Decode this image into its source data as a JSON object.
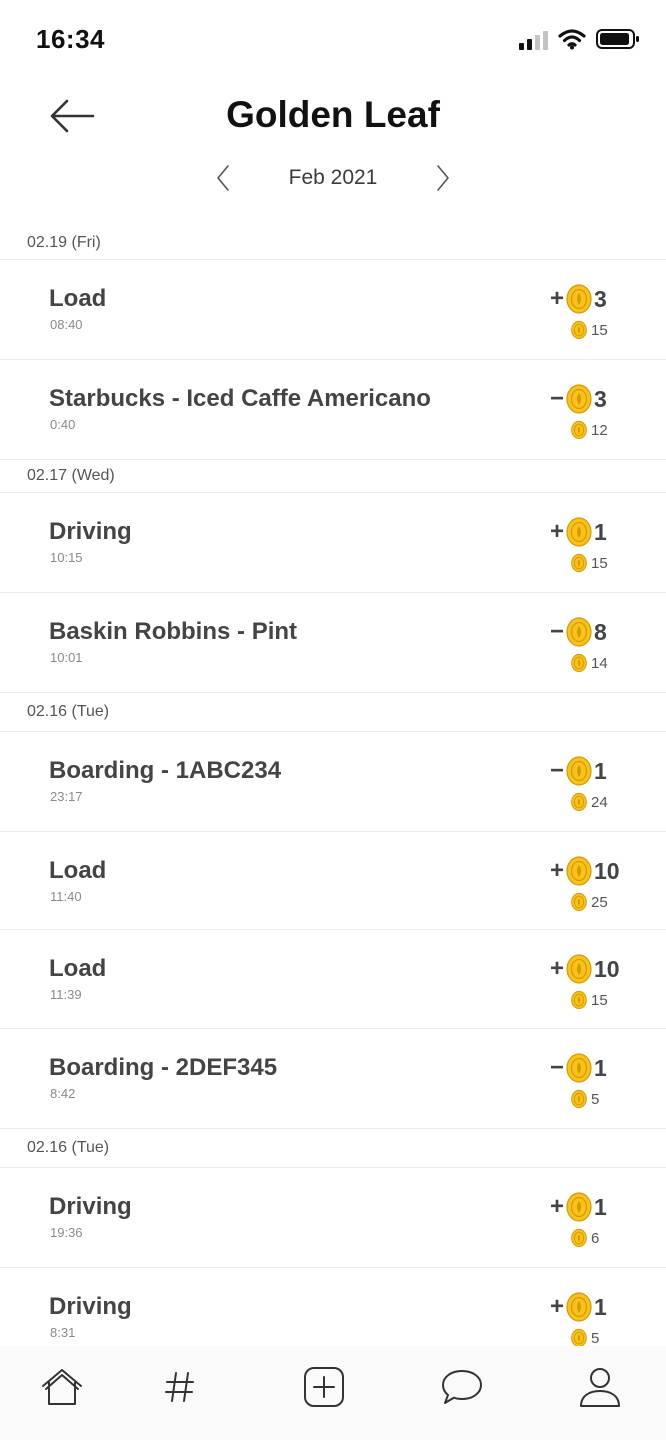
{
  "status_bar": {
    "time": "16:34"
  },
  "header": {
    "title": "Golden Leaf",
    "month": "Feb 2021"
  },
  "sections": [
    {
      "date": "02.19 (Fri)",
      "transactions": [
        {
          "title": "Load",
          "time": "08:40",
          "sign": "+",
          "amount": "3",
          "balance": "15"
        },
        {
          "title": "Starbucks - Iced Caffe Americano",
          "time": "0:40",
          "sign": "−",
          "amount": "3",
          "balance": "12"
        }
      ]
    },
    {
      "date": "02.17 (Wed)",
      "transactions": [
        {
          "title": "Driving",
          "time": "10:15",
          "sign": "+",
          "amount": "1",
          "balance": "15"
        },
        {
          "title": "Baskin Robbins - Pint",
          "time": "10:01",
          "sign": "−",
          "amount": "8",
          "balance": "14"
        }
      ]
    },
    {
      "date": "02.16 (Tue)",
      "transactions": [
        {
          "title": "Boarding - 1ABC234",
          "time": "23:17",
          "sign": "−",
          "amount": "1",
          "balance": "24"
        },
        {
          "title": "Load",
          "time": "11:40",
          "sign": "+",
          "amount": "10",
          "balance": "25"
        },
        {
          "title": "Load",
          "time": "11:39",
          "sign": "+",
          "amount": "10",
          "balance": "15"
        },
        {
          "title": "Boarding - 2DEF345",
          "time": "8:42",
          "sign": "−",
          "amount": "1",
          "balance": "5"
        }
      ]
    },
    {
      "date": "02.16 (Tue)",
      "transactions": [
        {
          "title": "Driving",
          "time": "19:36",
          "sign": "+",
          "amount": "1",
          "balance": "6"
        },
        {
          "title": "Driving",
          "time": "8:31",
          "sign": "+",
          "amount": "1",
          "balance": "5"
        }
      ]
    }
  ],
  "bottom_nav": [
    {
      "icon": "home-icon"
    },
    {
      "icon": "hashtag-icon"
    },
    {
      "icon": "add-icon"
    },
    {
      "icon": "chat-icon"
    },
    {
      "icon": "profile-icon"
    }
  ],
  "colors": {
    "coin": "#f7c21a",
    "coin_edge": "#d89a00",
    "divider": "#ebebeb"
  }
}
